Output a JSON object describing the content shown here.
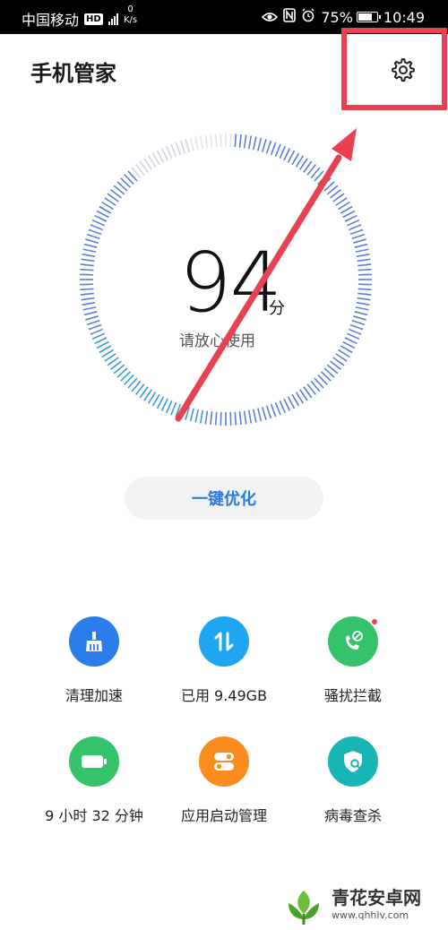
{
  "status_bar": {
    "carrier": "中国移动",
    "hd_badge": "HD",
    "speed_value": "0",
    "speed_unit": "K/s",
    "battery_percent_text": "75%",
    "battery_level": 0.75,
    "time": "10:49",
    "icons": [
      "eye-icon",
      "nfc-icon",
      "alarm-icon",
      "battery-icon",
      "signal-icon"
    ]
  },
  "header": {
    "title": "手机管家",
    "settings_icon": "gear-icon"
  },
  "score": {
    "value": "94",
    "unit": "分",
    "status": "请放心使用"
  },
  "optimize_button": {
    "label": "一键优化"
  },
  "tools": [
    {
      "label": "清理加速",
      "icon": "broom-icon",
      "color": "#2b7de9"
    },
    {
      "label": "已用 9.49GB",
      "icon": "data-transfer-icon",
      "color": "#1ea7f0"
    },
    {
      "label": "骚扰拦截",
      "icon": "phone-block-icon",
      "color": "#34c36a",
      "badge": true
    },
    {
      "label": "9 小时 32 分钟",
      "icon": "battery-icon",
      "color": "#34c36a"
    },
    {
      "label": "应用启动管理",
      "icon": "toggle-icon",
      "color": "#fb8c1e"
    },
    {
      "label": "病毒查杀",
      "icon": "shield-search-icon",
      "color": "#18b6b4"
    }
  ],
  "watermark": {
    "name": "青花安卓网",
    "url": "www.qhhlv.com"
  },
  "colors": {
    "accent": "#2a7be0",
    "highlight_red": "#e8414f",
    "gauge_blue": "#5b7fd6"
  }
}
